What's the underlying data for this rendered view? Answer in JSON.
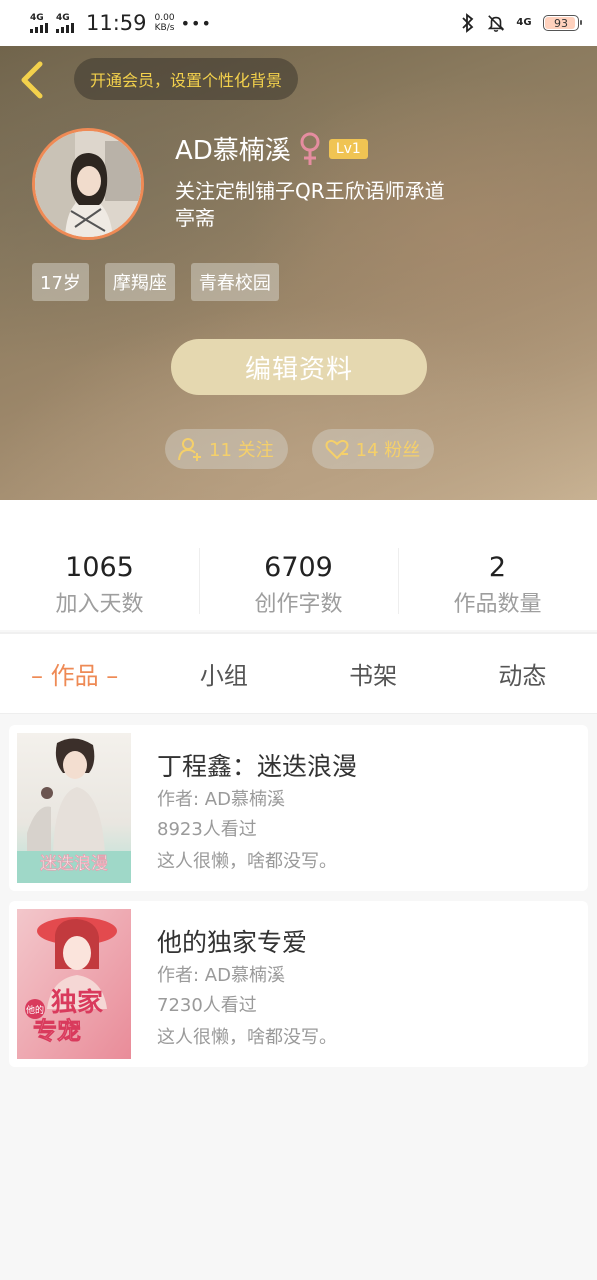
{
  "status_bar": {
    "sim1": "4G",
    "sim2": "4G",
    "time": "11:59",
    "speed_value": "0.00",
    "speed_unit": "KB/s",
    "more": "•••",
    "net_label": "4G",
    "battery": "93",
    "battery_level": 0.93
  },
  "header": {
    "vip_text": "开通会员，设置个性化背景",
    "username": "AD慕楠溪",
    "level": "Lv1",
    "bio": "关注定制铺子QR王欣语师承道亭斋",
    "tags": [
      "17岁",
      "摩羯座",
      "青春校园"
    ],
    "edit_button": "编辑资料",
    "following": "11 关注",
    "followers": "14 粉丝"
  },
  "stats": [
    {
      "value": "1065",
      "label": "加入天数"
    },
    {
      "value": "6709",
      "label": "创作字数"
    },
    {
      "value": "2",
      "label": "作品数量"
    }
  ],
  "tabs": [
    "– 作品 –",
    "小组",
    "书架",
    "动态"
  ],
  "works": [
    {
      "title": "丁程鑫：迷迭浪漫",
      "author": "作者: AD慕楠溪",
      "views": "8923人看过",
      "intro": "这人很懒，啥都没写。",
      "cover_text": "迷迭浪漫"
    },
    {
      "title": "他的独家专爱",
      "author": "作者: AD慕楠溪",
      "views": "7230人看过",
      "intro": "这人很懒，啥都没写。",
      "cover_text_1": "独家",
      "cover_text_2": "专宠",
      "cover_small": "他的"
    }
  ],
  "colors": {
    "accent": "#ee8a55",
    "vip_text": "#f3d14c",
    "level_badge": "#f0c453",
    "gender": "#e58da0"
  }
}
